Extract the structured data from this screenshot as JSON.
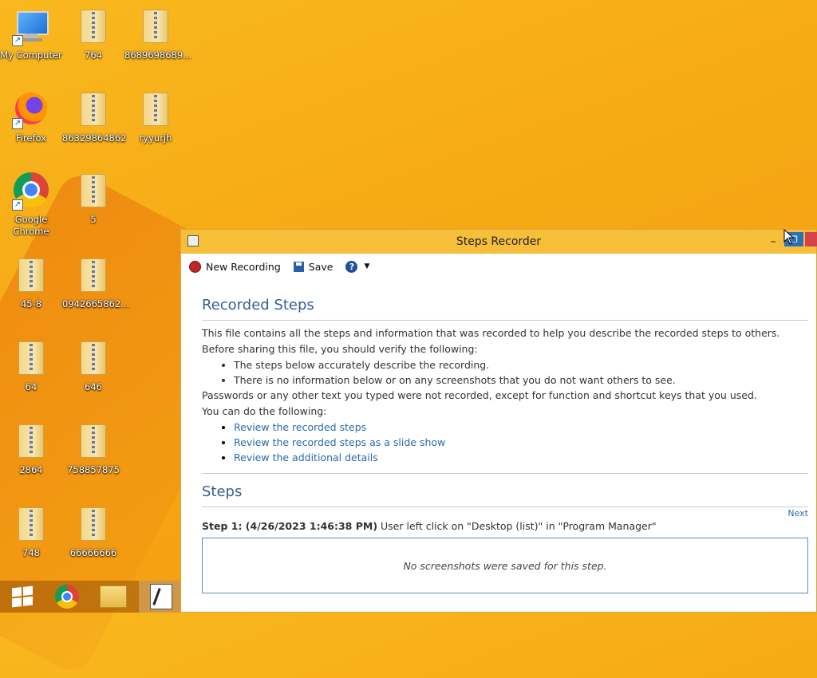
{
  "desktop": {
    "icons": [
      {
        "label": "My Computer",
        "icon": "computer-icon"
      },
      {
        "label": "764",
        "icon": "zip-folder-icon"
      },
      {
        "label": "8689698689...",
        "icon": "zip-folder-icon"
      },
      {
        "label": "Firefox",
        "icon": "firefox-icon"
      },
      {
        "label": "86329864862",
        "icon": "zip-folder-icon"
      },
      {
        "label": "ryyurjh",
        "icon": "zip-folder-icon"
      },
      {
        "label": "Google Chrome",
        "icon": "chrome-icon"
      },
      {
        "label": "5",
        "icon": "zip-folder-icon"
      },
      {
        "label": "45-8",
        "icon": "zip-folder-icon"
      },
      {
        "label": "0942665862...",
        "icon": "zip-folder-icon"
      },
      {
        "label": "64",
        "icon": "zip-folder-icon"
      },
      {
        "label": "646",
        "icon": "zip-folder-icon"
      },
      {
        "label": "2864",
        "icon": "zip-folder-icon"
      },
      {
        "label": "758857875",
        "icon": "zip-folder-icon"
      },
      {
        "label": "748",
        "icon": "zip-folder-icon"
      },
      {
        "label": "66666666",
        "icon": "zip-folder-icon"
      }
    ]
  },
  "taskbar": {
    "items": [
      "start-icon",
      "chrome-icon",
      "file-explorer-icon",
      "steps-recorder-icon"
    ]
  },
  "window": {
    "title": "Steps Recorder",
    "toolbar": {
      "new_recording": "New Recording",
      "save": "Save",
      "help": "?"
    },
    "recorded_steps": {
      "heading": "Recorded Steps",
      "intro": "This file contains all the steps and information that was recorded to help you describe the recorded steps to others.",
      "verify": "Before sharing this file, you should verify the following:",
      "bullets": [
        "The steps below accurately describe the recording.",
        "There is no information below or on any screenshots that you do not want others to see."
      ],
      "passwords_note": "Passwords or any other text you typed were not recorded, except for function and shortcut keys that you used.",
      "can_do": "You can do the following:",
      "links": [
        "Review the recorded steps",
        "Review the recorded steps as a slide show",
        "Review the additional details"
      ]
    },
    "steps": {
      "heading": "Steps",
      "next": "Next",
      "step1_bold": "Step 1: (4/26/2023 1:46:38 PM)",
      "step1_text": " User left click on \"Desktop (list)\" in \"Program Manager\"",
      "no_screenshot": "No screenshots were saved for this step."
    }
  },
  "colors": {
    "titlebar": "#f7be3a",
    "heading": "#355f90",
    "link": "#2a6aa8",
    "record": "#c0252b"
  }
}
